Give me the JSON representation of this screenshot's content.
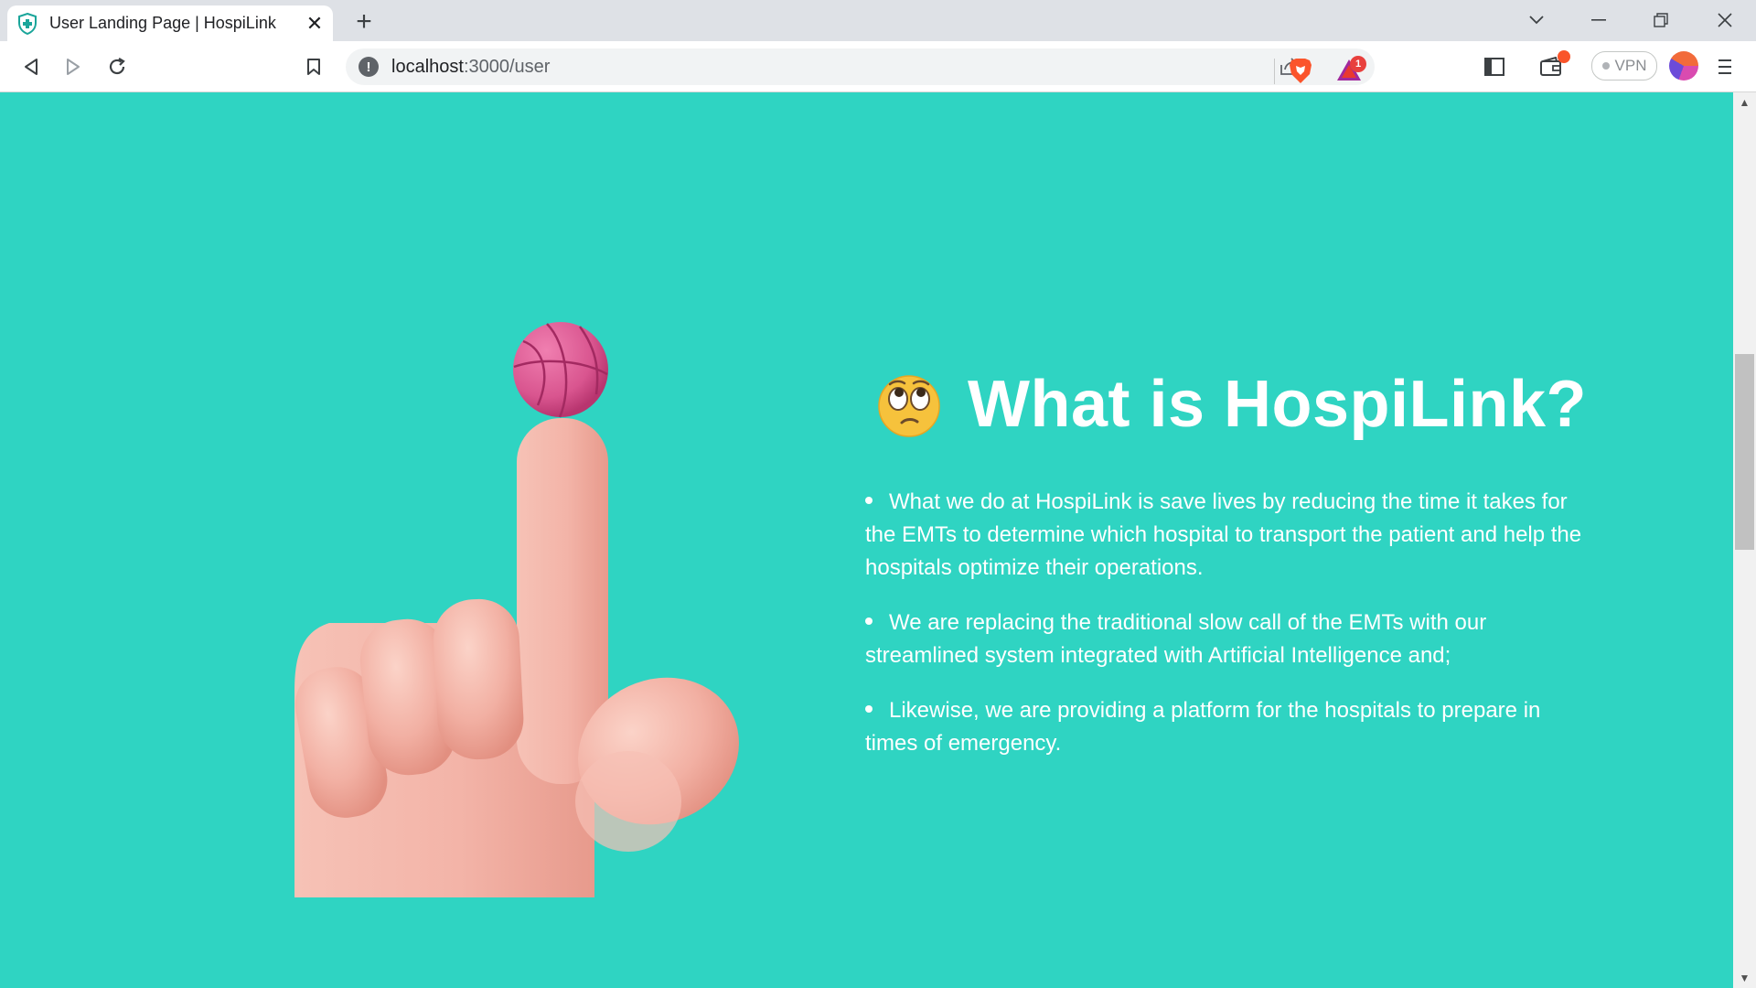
{
  "browser": {
    "tab_title": "User Landing Page | HospiLink",
    "url_host": "localhost",
    "url_path": ":3000/user",
    "vpn_label": "VPN",
    "rewards_badge": "1"
  },
  "page": {
    "heading": "What is HospiLink?",
    "heading_emoji": "face-with-rolling-eyes-emoji",
    "points": [
      "What we do at HospiLink is save lives by reducing the time it takes for the EMTs to determine which hospital to transport the patient and help the hospitals optimize their operations.",
      "We are replacing the traditional slow call of the EMTs with our streamlined system integrated with Artificial Intelligence and;",
      "Likewise, we are providing a platform for the hospitals to prepare in times of emergency."
    ],
    "illustration": "hand-pointing-up-with-basketball-illustration"
  },
  "colors": {
    "background": "#2fd4c2",
    "text": "#ffffff",
    "skin": "#f2b3a7",
    "ball": "#d9558f"
  }
}
